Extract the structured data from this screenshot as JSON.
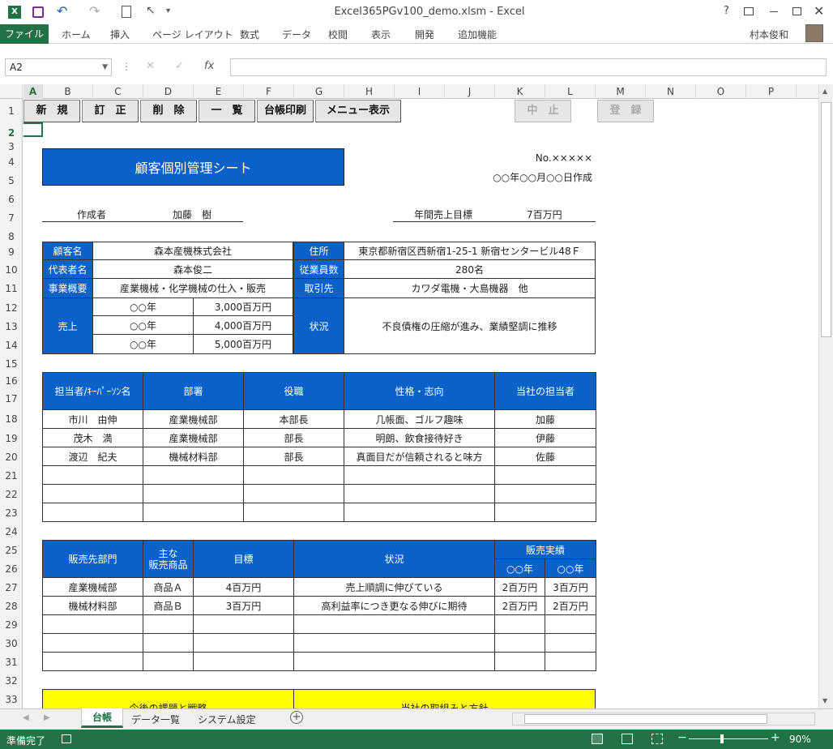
{
  "window": {
    "title": "Excel365PGv100_demo.xlsm - Excel",
    "user": "村本俊和"
  },
  "ribbon": {
    "file": "ファイル",
    "tabs": [
      "ホーム",
      "挿入",
      "ページ レイアウト",
      "数式",
      "データ",
      "校閲",
      "表示",
      "開発",
      "追加機能"
    ]
  },
  "formula": {
    "namebox": "A2",
    "fx": "fx"
  },
  "columns": [
    "A",
    "B",
    "C",
    "D",
    "E",
    "F",
    "G",
    "H",
    "I",
    "J",
    "K",
    "L",
    "M",
    "N",
    "O",
    "P"
  ],
  "rows": [
    "1",
    "2",
    "3",
    "4",
    "5",
    "6",
    "7",
    "8",
    "9",
    "10",
    "11",
    "12",
    "13",
    "14",
    "15",
    "16",
    "17",
    "18",
    "19",
    "20",
    "21",
    "22",
    "23",
    "24",
    "25",
    "26",
    "27",
    "28",
    "29",
    "30",
    "31",
    "32",
    "33"
  ],
  "buttons": {
    "new": "新　規",
    "edit": "訂　正",
    "delete": "削　除",
    "list": "一　覧",
    "print": "台帳印刷",
    "menu": "メニュー表示",
    "cancel": "中　止",
    "register": "登　録"
  },
  "sheet": {
    "title": "顧客個別管理シート",
    "no": "No.×××××",
    "created": "○○年○○月○○日作成",
    "author_label": "作成者",
    "author": "加藤　樹",
    "target_label": "年間売上目標",
    "target": "7百万円"
  },
  "info": {
    "customer_label": "顧客名",
    "customer": "森本産機株式会社",
    "address_label": "住所",
    "address": "東京都新宿区西新宿1-25-1 新宿センタービル48Ｆ",
    "rep_label": "代表者名",
    "rep": "森本俊二",
    "emp_label": "従業員数",
    "emp": "280名",
    "biz_label": "事業概要",
    "biz": "産業機械・化学機械の仕入・販売",
    "partner_label": "取引先",
    "partner": "カワダ電機・大島機器　他",
    "sales_label": "売上",
    "status_label": "状況",
    "status": "不良債権の圧縮が進み、業績堅調に推移",
    "sales": [
      {
        "year": "○○年",
        "amount": "3,000百万円"
      },
      {
        "year": "○○年",
        "amount": "4,000百万円"
      },
      {
        "year": "○○年",
        "amount": "5,000百万円"
      }
    ]
  },
  "contacts": {
    "headers": [
      "担当者/ｷｰﾊﾟｰｿﾝ名",
      "部署",
      "役職",
      "性格・志向",
      "当社の担当者"
    ],
    "rows": [
      [
        "市川　由伸",
        "産業機械部",
        "本部長",
        "几帳面、ゴルフ趣味",
        "加藤"
      ],
      [
        "茂木　満",
        "産業機械部",
        "部長",
        "明朗、飲食接待好き",
        "伊藤"
      ],
      [
        "渡辺　紀夫",
        "機械材料部",
        "部長",
        "真面目だが信頼されると味方",
        "佐藤"
      ]
    ]
  },
  "sales_table": {
    "headers": [
      "販売先部門",
      "主な\n販売商品",
      "目標",
      "状況",
      "販売実績"
    ],
    "years": [
      "○○年",
      "○○年"
    ],
    "rows": [
      [
        "産業機械部",
        "商品Ａ",
        "4百万円",
        "売上順調に伸びている",
        "2百万円",
        "3百万円"
      ],
      [
        "機械材料部",
        "商品Ｂ",
        "3百万円",
        "高利益率につき更なる伸びに期待",
        "2百万円",
        "2百万円"
      ]
    ]
  },
  "bottom": {
    "left": "今後の課題と戦略",
    "right": "当社の取組みと方針"
  },
  "sheets": [
    "台帳",
    "データ一覧",
    "システム設定"
  ],
  "statusbar": {
    "ready": "準備完了",
    "zoom": "90%"
  }
}
